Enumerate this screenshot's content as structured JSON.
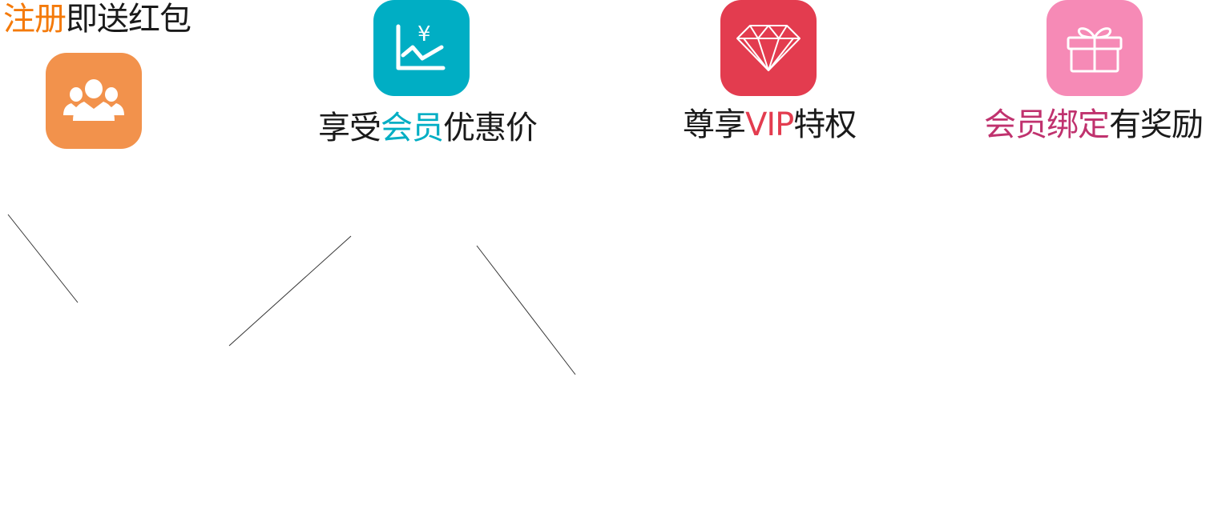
{
  "features": [
    {
      "id": "register",
      "highlight": "注册",
      "rest": "即送红包",
      "accent": "#f47a0a",
      "tile_color": "#f2924c",
      "icon": "users-icon"
    },
    {
      "id": "member-price",
      "prefix": "享受",
      "highlight": "会员",
      "suffix": "优惠价",
      "accent": "#00aec4",
      "tile_color": "#00aec4",
      "icon": "yen-chart-icon"
    },
    {
      "id": "vip",
      "prefix": "尊享",
      "highlight": "VIP",
      "suffix": "特权",
      "accent": "#e33c4f",
      "tile_color": "#e33c4f",
      "icon": "diamond-icon"
    },
    {
      "id": "bind",
      "highlight": "会员绑定",
      "rest": "有奖励",
      "accent": "#c0326e",
      "tile_color": "#f68ab6",
      "icon": "gift-icon"
    }
  ]
}
